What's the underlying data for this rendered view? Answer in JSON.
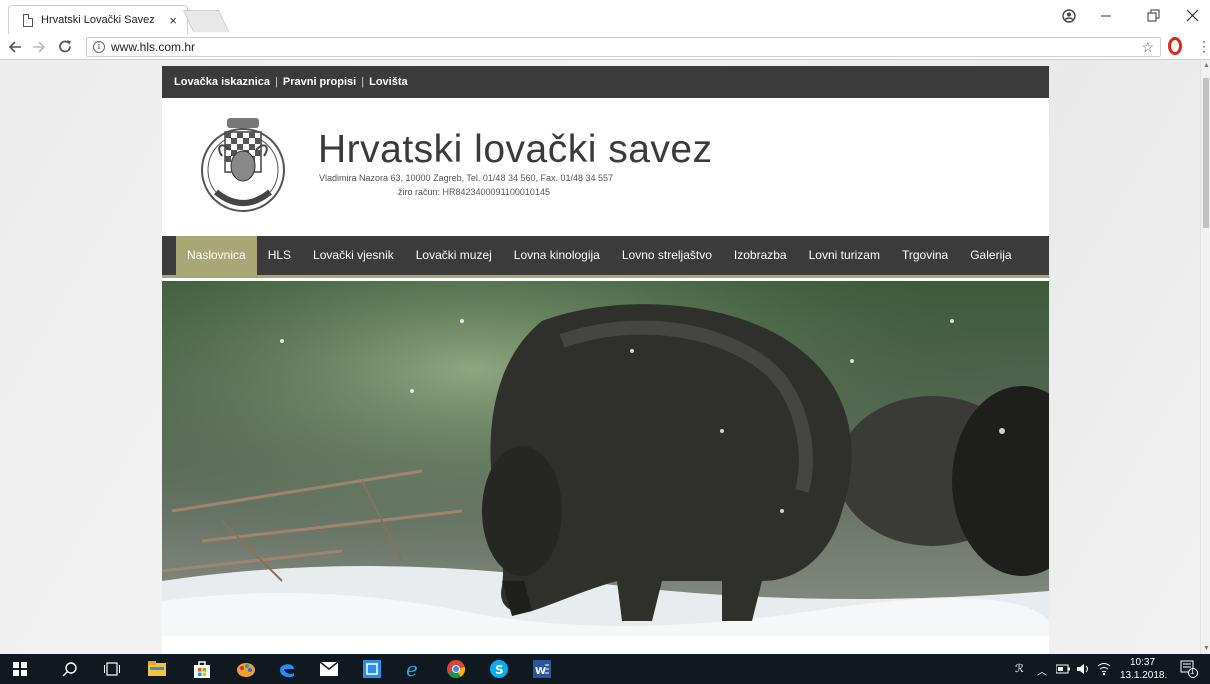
{
  "browser": {
    "tab_title": "Hrvatski Lovački Savez",
    "tab_close": "×",
    "url": "www.hls.com.hr",
    "info_glyph": "i"
  },
  "site": {
    "top_links": [
      "Lovačka iskaznica",
      "Pravni propisi",
      "Lovišta"
    ],
    "top_separator": "|",
    "title": "Hrvatski lovački savez",
    "address": "Vladimira Nazora 63, 10000 Zagreb, Tel. 01/48 34 560, Fax. 01/48 34 557",
    "account": "žiro račun: HR8423400091100010145",
    "nav": [
      "Naslovnica",
      "HLS",
      "Lovački vjesnik",
      "Lovački muzej",
      "Lovna kinologija",
      "Lovno streljaštvo",
      "Izobrazba",
      "Lovni turizam",
      "Trgovina",
      "Galerija"
    ],
    "active_nav_index": 0,
    "colors": {
      "dark": "#3b3b3b",
      "accent": "#a7a876"
    }
  },
  "taskbar": {
    "time": "10:37",
    "date": "13.1.2018.",
    "notification_count": "1",
    "icons": [
      "windows-start-icon",
      "search-icon",
      "task-view-icon",
      "file-explorer-icon",
      "store-icon",
      "paint-icon",
      "edge-icon",
      "mail-icon",
      "outlook-icon",
      "internet-explorer-icon",
      "chrome-icon",
      "skype-icon",
      "word-icon"
    ]
  }
}
